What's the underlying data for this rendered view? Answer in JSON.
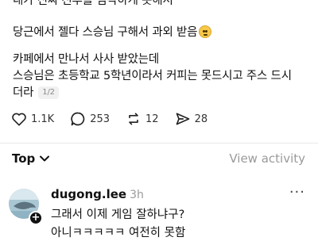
{
  "post": {
    "line1": "내가 진짜 선투를 심각하게 못해서",
    "line2": "당근에서 젤다 스승님 구해서 과외 받음",
    "line3": "카페에서 만나서 사사 받았는데",
    "line4": "스승님은 초등학교 5학년이라서 커피는 못드시고 주스 드시",
    "line5": "더라",
    "page_indicator": "1/2",
    "emoji_icon": "smiling-face-icon"
  },
  "actions": {
    "likes": "1.1K",
    "comments": "253",
    "reposts": "12",
    "shares": "28"
  },
  "sort": {
    "label": "Top",
    "view_activity": "View activity"
  },
  "comment": {
    "author": "dugong.lee",
    "time": "3h",
    "line1": "그래서 이제 게임 잘하냐구?",
    "line2": "아니ㅋㅋㅋㅋㅋ 여전히 못함"
  }
}
